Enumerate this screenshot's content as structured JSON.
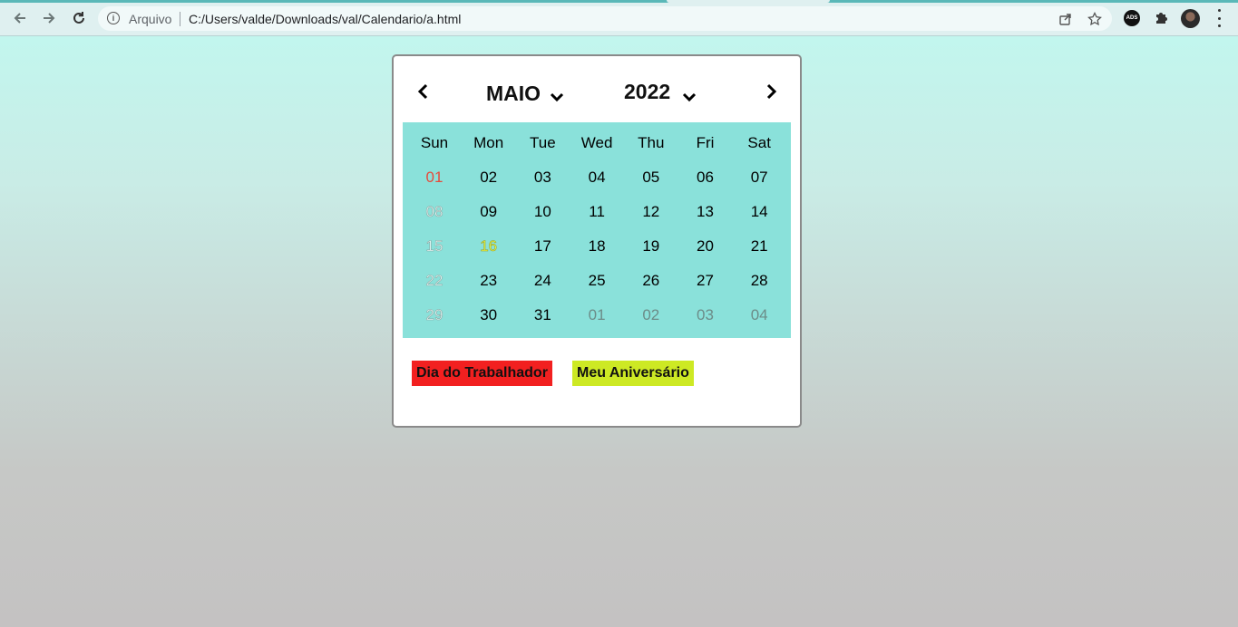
{
  "browser": {
    "scheme_label": "Arquivo",
    "url": "C:/Users/valde/Downloads/val/Calendario/a.html",
    "ext_ads_label": "ADS"
  },
  "calendar": {
    "month": "MAIO",
    "year": "2022",
    "weekdays": [
      "Sun",
      "Mon",
      "Tue",
      "Wed",
      "Thu",
      "Fri",
      "Sat"
    ],
    "weeks": [
      [
        "01",
        "02",
        "03",
        "04",
        "05",
        "06",
        "07"
      ],
      [
        "08",
        "09",
        "10",
        "11",
        "12",
        "13",
        "14"
      ],
      [
        "15",
        "16",
        "17",
        "18",
        "19",
        "20",
        "21"
      ],
      [
        "22",
        "23",
        "24",
        "25",
        "26",
        "27",
        "28"
      ],
      [
        "29",
        "30",
        "31",
        "01",
        "02",
        "03",
        "04"
      ]
    ],
    "grid_color": "#8ae1da"
  },
  "events": [
    {
      "label": "Dia do Trabalhador",
      "color": "#f22020"
    },
    {
      "label": "Meu Aniversário",
      "color": "#cde924"
    }
  ]
}
